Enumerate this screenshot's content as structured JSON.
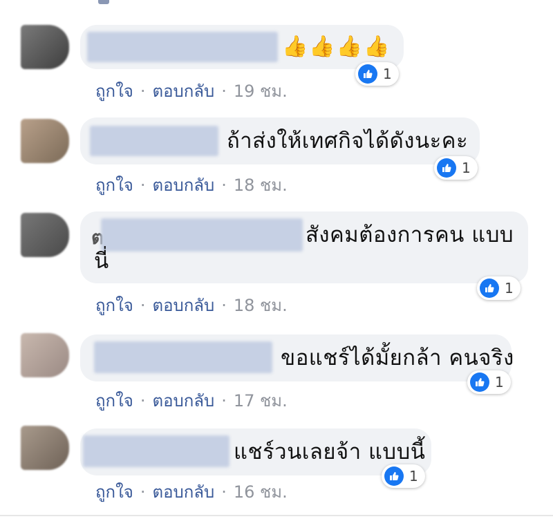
{
  "actions": {
    "like": "ถูกใจ",
    "reply": "ตอบกลับ",
    "separator": "·"
  },
  "reaction": {
    "type": "like-icon",
    "color": "#1877f2"
  },
  "comments": [
    {
      "text": "",
      "emoji": "👍👍👍👍",
      "reaction_count": "1",
      "time": "19 ชม."
    },
    {
      "text": "ถ้าส่งให้เทศกิจได้ดังนะคะ",
      "reaction_count": "1",
      "time": "18 ชม."
    },
    {
      "text_line1": "สังคมต้องการคน แบบ",
      "text_line2": "นี่",
      "name_prefix": "ต",
      "reaction_count": "1",
      "time": "18 ชม."
    },
    {
      "text": "ขอแชร์ได้มั้ยกล้า คนจริง",
      "reaction_count": "1",
      "time": "17 ชม."
    },
    {
      "text": "แชร์วนเลยจ้า แบบนี้",
      "reaction_count": "1",
      "time": "16 ชม."
    }
  ]
}
